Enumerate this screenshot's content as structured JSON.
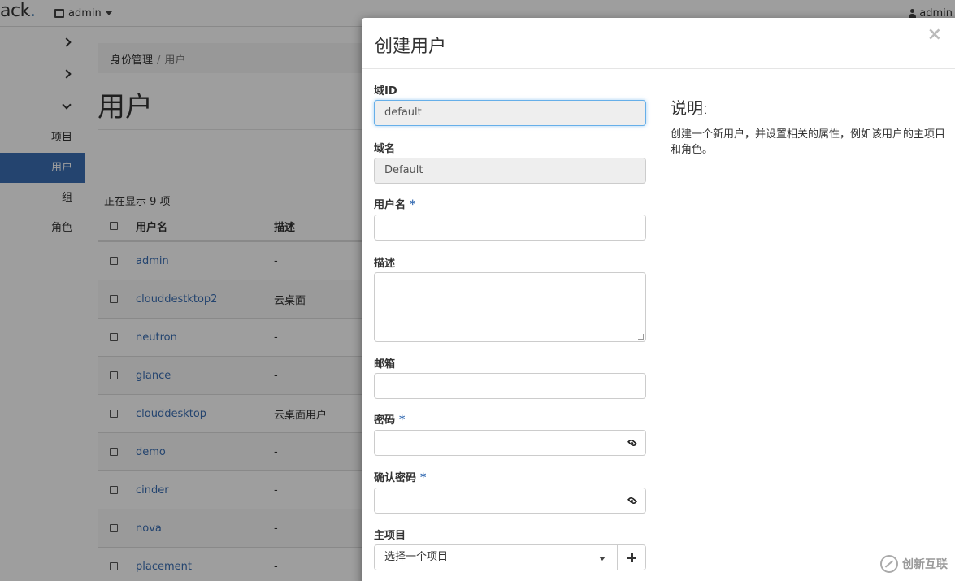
{
  "topbar": {
    "brand": "ack",
    "brand_dot": ".",
    "project_menu": "admin",
    "user_menu": "admin"
  },
  "sidebar": {
    "items": [
      {
        "label": "项目",
        "active": false
      },
      {
        "label": "用户",
        "active": true
      },
      {
        "label": "组",
        "active": false
      },
      {
        "label": "角色",
        "active": false
      }
    ]
  },
  "breadcrumb": {
    "parent": "身份管理",
    "separator": "/",
    "current": "用户"
  },
  "page_title": "用户",
  "table": {
    "count_text": "正在显示 9 项",
    "headers": {
      "name": "用户名",
      "description": "描述"
    },
    "rows": [
      {
        "name": "admin",
        "description": "-"
      },
      {
        "name": "clouddestktop2",
        "description": "云桌面"
      },
      {
        "name": "neutron",
        "description": "-"
      },
      {
        "name": "glance",
        "description": "-"
      },
      {
        "name": "clouddesktop",
        "description": "云桌面用户"
      },
      {
        "name": "demo",
        "description": "-"
      },
      {
        "name": "cinder",
        "description": "-"
      },
      {
        "name": "nova",
        "description": "-"
      },
      {
        "name": "placement",
        "description": "-"
      }
    ]
  },
  "modal": {
    "title": "创建用户",
    "close": "×",
    "fields": {
      "domain_id": {
        "label": "域ID",
        "value": "default"
      },
      "domain_name": {
        "label": "域名",
        "value": "Default"
      },
      "username": {
        "label": "用户名",
        "value": "",
        "required": "*"
      },
      "description": {
        "label": "描述",
        "value": ""
      },
      "email": {
        "label": "邮箱",
        "value": ""
      },
      "password": {
        "label": "密码",
        "value": "",
        "required": "*"
      },
      "confirm_password": {
        "label": "确认密码",
        "value": "",
        "required": "*"
      },
      "primary_project": {
        "label": "主项目",
        "selected": "选择一个项目"
      }
    },
    "help": {
      "title": "说明:",
      "text": "创建一个新用户，并设置相关的属性，例如该用户的主项目和角色。"
    }
  },
  "watermark": {
    "text": "创新互联"
  },
  "colors": {
    "accent": "#3a6fb4",
    "focus": "#66afe9",
    "overlay": "rgba(0,0,0,0.38)"
  }
}
